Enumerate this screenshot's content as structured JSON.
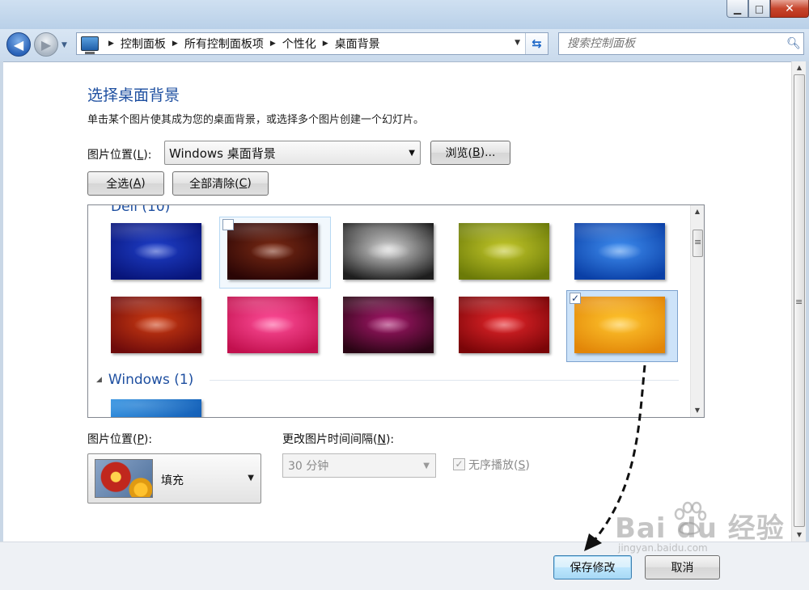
{
  "titlebar": {
    "min": "▁",
    "max": "□",
    "close": "✕"
  },
  "nav": {
    "back_glyph": "◀",
    "forward_glyph": "▶",
    "breadcrumbs": [
      "控制面板",
      "所有控制面板项",
      "个性化",
      "桌面背景"
    ],
    "search_placeholder": "搜索控制面板"
  },
  "page": {
    "title": "选择桌面背景",
    "description": "单击某个图片使其成为您的桌面背景，或选择多个图片创建一个幻灯片。",
    "picture_location_label": "图片位置(",
    "picture_location_key": "L",
    "picture_location_suffix": "):",
    "picture_location_value": "Windows 桌面背景",
    "browse_label": "浏览(",
    "browse_key": "B",
    "browse_suffix": ")...",
    "select_all_label": "全选(",
    "select_all_key": "A",
    "select_all_suffix": ")",
    "clear_all_label": "全部清除(",
    "clear_all_key": "C",
    "clear_all_suffix": ")"
  },
  "gallery": {
    "group_dell": "Dell (10)",
    "group_windows": "Windows (1)",
    "dell_colors": [
      [
        "#1f3fc9",
        "#08157a"
      ],
      [
        "#7a2a14",
        "#2a0505"
      ],
      [
        "#d8d8d8",
        "#1e1e1e"
      ],
      [
        "#c4c82a",
        "#6b7a08"
      ],
      [
        "#3f8ef0",
        "#0a3fa6"
      ],
      [
        "#cf3c12",
        "#6e0b0b"
      ],
      [
        "#ff4f9a",
        "#c2104e"
      ],
      [
        "#a8186c",
        "#2a0414"
      ],
      [
        "#e8262b",
        "#7a0508"
      ],
      [
        "#ffc62e",
        "#e28608"
      ]
    ],
    "checked_index": 9,
    "checked_mark": "✓"
  },
  "options": {
    "position_label": "图片位置(",
    "position_key": "P",
    "position_suffix": "):",
    "position_value": "填充",
    "interval_label": "更改图片时间间隔(",
    "interval_key": "N",
    "interval_suffix": "):",
    "interval_value": "30 分钟",
    "shuffle_label": "无序播放(",
    "shuffle_key": "S",
    "shuffle_suffix": ")",
    "shuffle_mark": "✓"
  },
  "footer": {
    "save_label": "保存修改",
    "cancel_label": "取消"
  },
  "watermark": {
    "brand": "Bai du 经验",
    "url": "jingyan.baidu.com"
  }
}
